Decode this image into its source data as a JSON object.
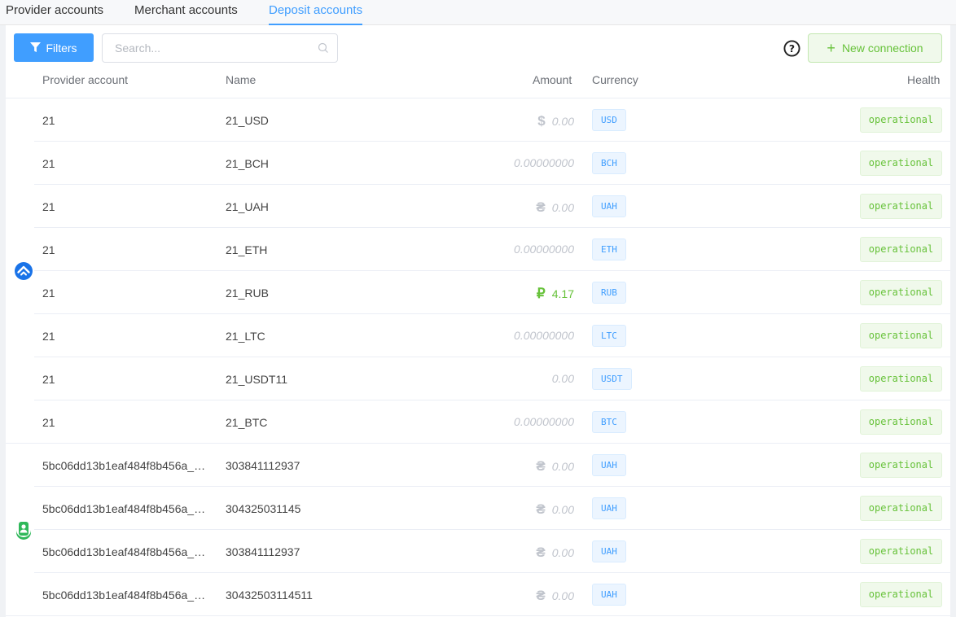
{
  "tabs": [
    {
      "label": "Provider accounts",
      "active": false
    },
    {
      "label": "Merchant accounts",
      "active": false
    },
    {
      "label": "Deposit accounts",
      "active": true
    }
  ],
  "toolbar": {
    "filters_label": "Filters",
    "search_placeholder": "Search...",
    "search_value": "",
    "new_connection_label": "New connection"
  },
  "columns": {
    "provider_account": "Provider account",
    "name": "Name",
    "amount": "Amount",
    "currency": "Currency",
    "health": "Health"
  },
  "groups": [
    {
      "provider_icon": "house-shield-icon",
      "rows": [
        {
          "provider_account": "21",
          "name": "21_USD",
          "amount_sign": "$",
          "amount": "0.00",
          "currency": "USD",
          "health": "operational"
        },
        {
          "provider_account": "21",
          "name": "21_BCH",
          "amount_sign": "",
          "amount": "0.00000000",
          "currency": "BCH",
          "health": "operational"
        },
        {
          "provider_account": "21",
          "name": "21_UAH",
          "amount_sign": "₴",
          "amount": "0.00",
          "currency": "UAH",
          "health": "operational"
        },
        {
          "provider_account": "21",
          "name": "21_ETH",
          "amount_sign": "",
          "amount": "0.00000000",
          "currency": "ETH",
          "health": "operational"
        },
        {
          "provider_account": "21",
          "name": "21_RUB",
          "amount_sign": "₽",
          "amount": "4.17",
          "currency": "RUB",
          "health": "operational",
          "positive": true
        },
        {
          "provider_account": "21",
          "name": "21_LTC",
          "amount_sign": "",
          "amount": "0.00000000",
          "currency": "LTC",
          "health": "operational"
        },
        {
          "provider_account": "21",
          "name": "21_USDT11",
          "amount_sign": "",
          "amount": "0.00",
          "currency": "USDT",
          "health": "operational"
        },
        {
          "provider_account": "21",
          "name": "21_BTC",
          "amount_sign": "",
          "amount": "0.00000000",
          "currency": "BTC",
          "health": "operational"
        }
      ]
    },
    {
      "provider_icon": "person-badge-icon",
      "rows": [
        {
          "provider_account": "5bc06dd13b1eaf484f8b456a_…",
          "name": "303841112937",
          "amount_sign": "₴",
          "amount": "0.00",
          "currency": "UAH",
          "health": "operational"
        },
        {
          "provider_account": "5bc06dd13b1eaf484f8b456a_…",
          "name": "304325031145",
          "amount_sign": "₴",
          "amount": "0.00",
          "currency": "UAH",
          "health": "operational"
        },
        {
          "provider_account": "5bc06dd13b1eaf484f8b456a_…",
          "name": "303841112937",
          "amount_sign": "₴",
          "amount": "0.00",
          "currency": "UAH",
          "health": "operational"
        },
        {
          "provider_account": "5bc06dd13b1eaf484f8b456a_…",
          "name": "30432503114511",
          "amount_sign": "₴",
          "amount": "0.00",
          "currency": "UAH",
          "health": "operational"
        }
      ]
    }
  ],
  "colors": {
    "accent": "#409eff",
    "success": "#67c23a",
    "muted": "#c0c4cc"
  }
}
